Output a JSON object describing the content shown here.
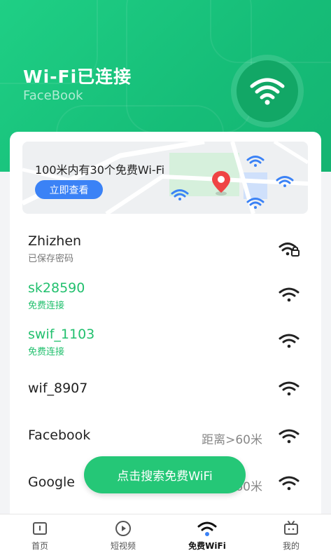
{
  "header": {
    "title": "Wi-Fi已连接",
    "ssid": "FaceBook",
    "accent": "#1fcf85"
  },
  "map_card": {
    "text": "100米内有30个免费Wi-Fi",
    "button": "立即查看"
  },
  "networks": [
    {
      "name": "Zhizhen",
      "status": "已保存密码",
      "distance": "",
      "locked": true,
      "highlight": false
    },
    {
      "name": "sk28590",
      "status": "免费连接",
      "distance": "",
      "locked": false,
      "highlight": true
    },
    {
      "name": "swif_1103",
      "status": "免费连接",
      "distance": "",
      "locked": false,
      "highlight": true
    },
    {
      "name": "wif_8907",
      "status": "",
      "distance": "",
      "locked": false,
      "highlight": false
    },
    {
      "name": "Facebook",
      "status": "",
      "distance": "距离>60米",
      "locked": false,
      "highlight": false
    },
    {
      "name": "Google",
      "status": "",
      "distance": "距离>60米",
      "locked": false,
      "highlight": false
    }
  ],
  "fab": {
    "label": "点击搜索免费WiFi"
  },
  "tabs": [
    {
      "label": "首页",
      "icon": "home-icon"
    },
    {
      "label": "短视频",
      "icon": "play-icon"
    },
    {
      "label": "免费WiFi",
      "icon": "wifi-icon"
    },
    {
      "label": "我的",
      "icon": "tv-icon"
    }
  ]
}
